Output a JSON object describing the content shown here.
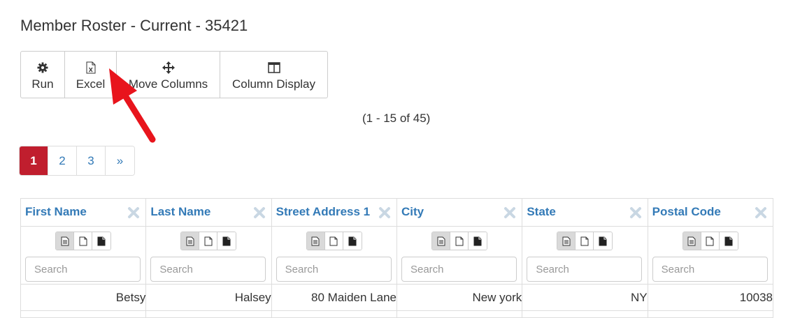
{
  "page": {
    "title": "Member Roster - Current - 35421"
  },
  "toolbar": {
    "run": {
      "label": "Run",
      "icon": "gear-icon"
    },
    "excel": {
      "label": "Excel",
      "icon": "excel-file-icon"
    },
    "move_columns": {
      "label": "Move Columns",
      "icon": "move-arrows-icon"
    },
    "column_display": {
      "label": "Column Display",
      "icon": "columns-icon"
    }
  },
  "record_count": "(1 - 15 of 45)",
  "pagination": {
    "pages": [
      "1",
      "2",
      "3"
    ],
    "current": "1",
    "next_label": "»"
  },
  "grid": {
    "columns": [
      {
        "label": "First Name",
        "placeholder": "Search"
      },
      {
        "label": "Last Name",
        "placeholder": "Search"
      },
      {
        "label": "Street Address 1",
        "placeholder": "Search"
      },
      {
        "label": "City",
        "placeholder": "Search"
      },
      {
        "label": "State",
        "placeholder": "Search"
      },
      {
        "label": "Postal Code",
        "placeholder": "Search"
      }
    ],
    "rows": [
      [
        "Betsy",
        "Halsey",
        "80 Maiden Lane",
        "New york",
        "NY",
        "10038"
      ]
    ]
  },
  "colors": {
    "accent": "#c01e2e",
    "link": "#337ab7",
    "annotation_arrow": "#e8141c"
  }
}
